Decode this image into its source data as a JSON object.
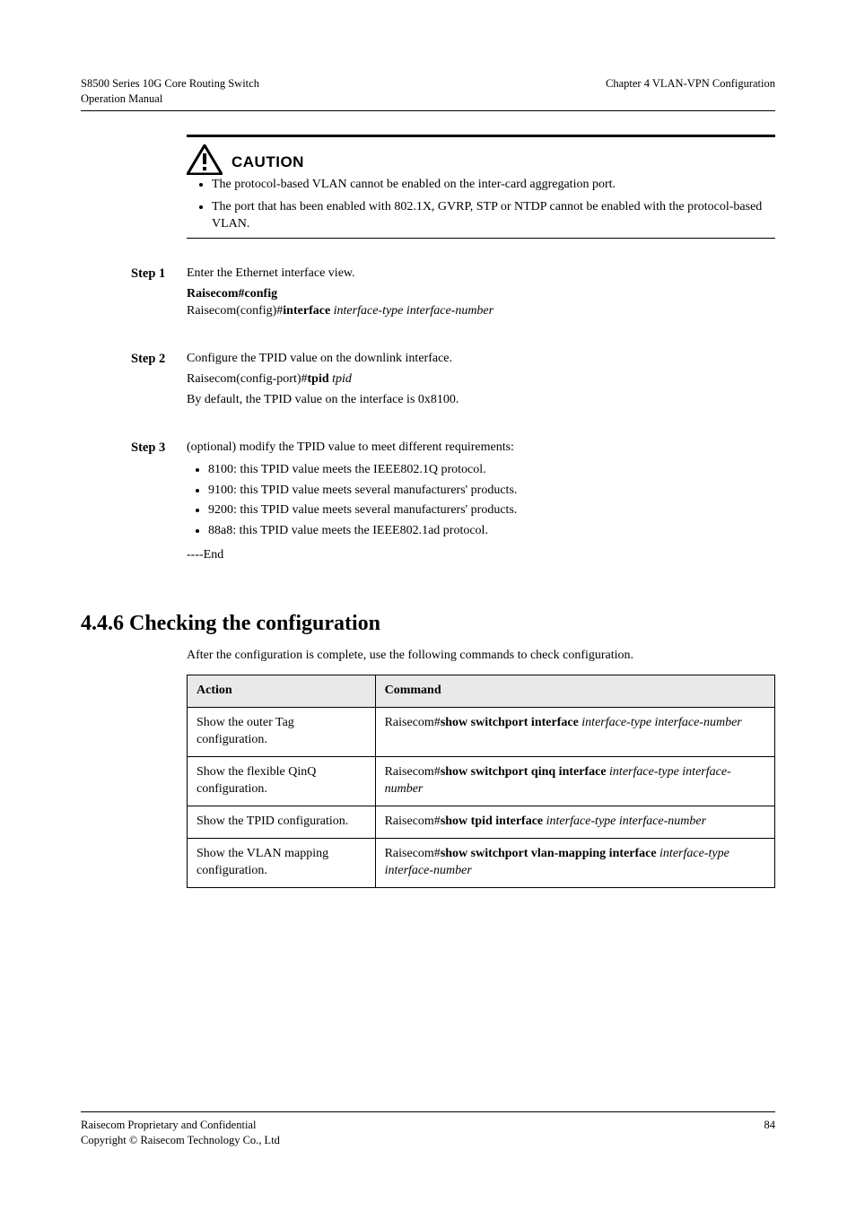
{
  "header": {
    "product": "S8500 Series 10G Core Routing Switch",
    "doc_title": "Operation Manual",
    "chapter": "Chapter 4  VLAN-VPN Configuration"
  },
  "caution": {
    "label": "CAUTION",
    "items": [
      "The protocol-based VLAN cannot be enabled on the inter-card aggregation port.",
      "The port that has been enabled with 802.1X, GVRP, STP or NTDP cannot be enabled with the protocol-based VLAN."
    ]
  },
  "steps": [
    {
      "label": "Step 1",
      "title": "Enter the Ethernet interface view.",
      "cmd": [
        {
          "t": "Raisecom#",
          "b": true
        },
        {
          "t": "config",
          "b": true
        },
        {
          "t": "\n"
        },
        {
          "t": "Raisecom(config)#",
          "b": false
        },
        {
          "t": "interface ",
          "b": true
        },
        {
          "t": "interface-type interface-number",
          "i": true
        }
      ]
    },
    {
      "label": "Step 2",
      "title": "Configure the TPID value on the downlink interface.",
      "cmd": [
        {
          "t": "Raisecom(config-port)#",
          "b": false
        },
        {
          "t": "tpid ",
          "b": true
        },
        {
          "t": "tpid",
          "i": true
        }
      ],
      "note": "By default, the TPID value on the interface is 0x8100."
    },
    {
      "label": "Step 3",
      "title": "(optional) modify the TPID value to meet different requirements:",
      "bullets": [
        "8100: this TPID value meets the IEEE802.1Q protocol.",
        "9100: this TPID value meets several manufacturers' products.",
        "9200: this TPID value meets several manufacturers' products.",
        "88a8: this TPID value meets the IEEE802.1ad protocol."
      ],
      "end": "----End"
    }
  ],
  "section_title": "4.4.6 Checking the configuration",
  "lead": "After the configuration is complete, use the following commands to check configuration.",
  "table": {
    "headers": [
      "Action",
      "Command"
    ],
    "rows": [
      {
        "action": "Show the outer Tag configuration.",
        "cmd": [
          {
            "t": "Raisecom#",
            "b": false
          },
          {
            "t": "show switchport interface ",
            "b": true
          },
          {
            "t": "interface-type interface-number",
            "i": true
          }
        ]
      },
      {
        "action": "Show the flexible QinQ configuration.",
        "cmd": [
          {
            "t": "Raisecom#",
            "b": false
          },
          {
            "t": "show switchport qinq interface ",
            "b": true
          },
          {
            "t": "interface-type interface-number",
            "i": true
          }
        ]
      },
      {
        "action": "Show the TPID configuration.",
        "cmd": [
          {
            "t": "Raisecom#",
            "b": false
          },
          {
            "t": "show tpid interface ",
            "b": true
          },
          {
            "t": "interface-type interface-number",
            "i": true
          }
        ]
      },
      {
        "action": "Show the VLAN mapping configuration.",
        "cmd": [
          {
            "t": "Raisecom#",
            "b": false
          },
          {
            "t": "show switchport vlan-mapping interface ",
            "b": true
          },
          {
            "t": "interface-type interface-number",
            "i": true
          }
        ]
      }
    ]
  },
  "footer": {
    "company": "Raisecom Proprietary and Confidential",
    "copyright": "Copyright © Raisecom Technology Co., Ltd",
    "page": "84"
  }
}
